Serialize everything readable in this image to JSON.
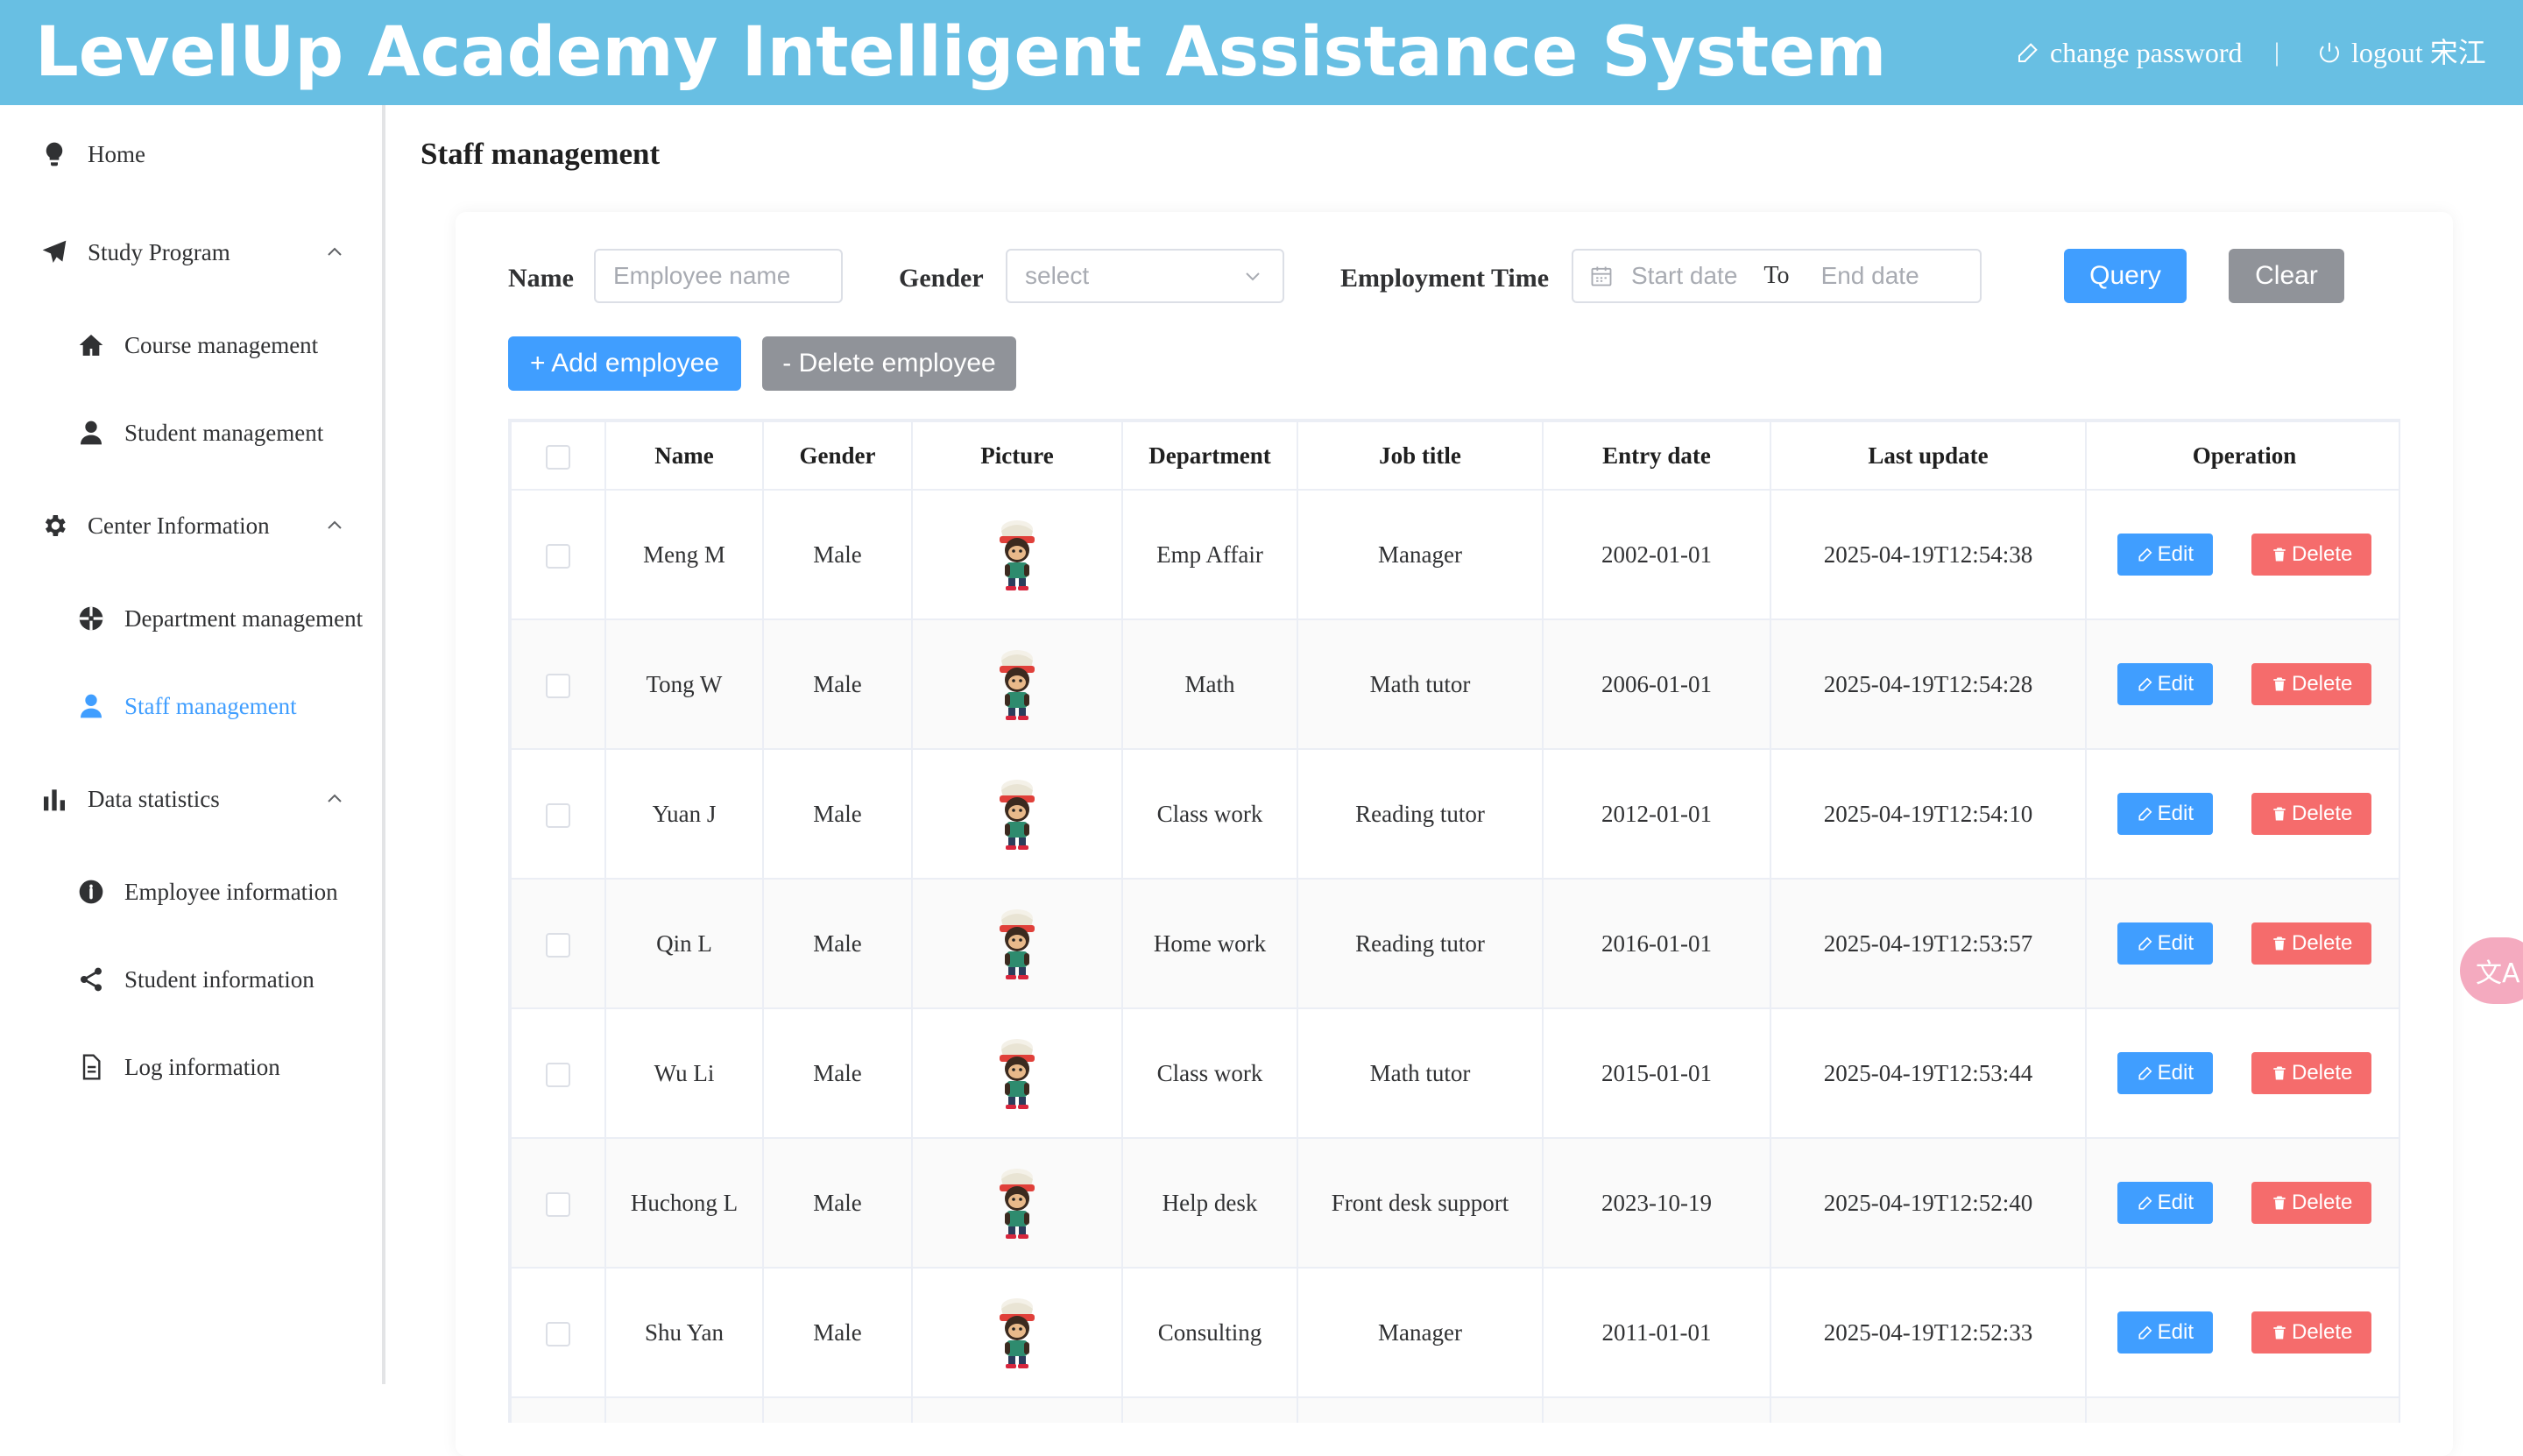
{
  "header": {
    "title": "LevelUp Academy Intelligent Assistance System",
    "change_password": "change password",
    "separator": "|",
    "logout": "logout 宋江"
  },
  "sidebar": {
    "items": [
      {
        "label": "Home",
        "icon": "lightbulb-icon"
      },
      {
        "label": "Study Program",
        "icon": "paper-plane-icon",
        "expanded": true
      },
      {
        "label": "Course management",
        "icon": "home-icon"
      },
      {
        "label": "Student management",
        "icon": "user-icon"
      },
      {
        "label": "Center Information",
        "icon": "gear-icon",
        "expanded": true
      },
      {
        "label": "Department management",
        "icon": "aperture-icon"
      },
      {
        "label": "Staff management",
        "icon": "user-icon",
        "active": true
      },
      {
        "label": "Data statistics",
        "icon": "bar-chart-icon",
        "expanded": true
      },
      {
        "label": "Employee information",
        "icon": "info-icon"
      },
      {
        "label": "Student information",
        "icon": "share-icon"
      },
      {
        "label": "Log information",
        "icon": "document-icon"
      }
    ]
  },
  "page": {
    "title": "Staff management"
  },
  "filters": {
    "name_label": "Name",
    "name_placeholder": "Employee name",
    "gender_label": "Gender",
    "gender_placeholder": "select",
    "time_label": "Employment Time",
    "start_placeholder": "Start date",
    "range_separator": "To",
    "end_placeholder": "End date",
    "query_label": "Query",
    "clear_label": "Clear"
  },
  "actions": {
    "add_label": "+ Add employee",
    "delete_label": "- Delete employee"
  },
  "table": {
    "columns": [
      "Name",
      "Gender",
      "Picture",
      "Department",
      "Job title",
      "Entry date",
      "Last update",
      "Operation"
    ],
    "edit_label": "Edit",
    "delete_label": "Delete",
    "rows": [
      {
        "name": "Meng M",
        "gender": "Male",
        "department": "Emp Affair",
        "job": "Manager",
        "entry": "2002-01-01",
        "updated": "2025-04-19T12:54:38"
      },
      {
        "name": "Tong W",
        "gender": "Male",
        "department": "Math",
        "job": "Math tutor",
        "entry": "2006-01-01",
        "updated": "2025-04-19T12:54:28"
      },
      {
        "name": "Yuan J",
        "gender": "Male",
        "department": "Class work",
        "job": "Reading tutor",
        "entry": "2012-01-01",
        "updated": "2025-04-19T12:54:10"
      },
      {
        "name": "Qin L",
        "gender": "Male",
        "department": "Home work",
        "job": "Reading tutor",
        "entry": "2016-01-01",
        "updated": "2025-04-19T12:53:57"
      },
      {
        "name": "Wu Li",
        "gender": "Male",
        "department": "Class work",
        "job": "Math tutor",
        "entry": "2015-01-01",
        "updated": "2025-04-19T12:53:44"
      },
      {
        "name": "Huchong L",
        "gender": "Male",
        "department": "Help desk",
        "job": "Front desk support",
        "entry": "2023-10-19",
        "updated": "2025-04-19T12:52:40"
      },
      {
        "name": "Shu Yan",
        "gender": "Male",
        "department": "Consulting",
        "job": "Manager",
        "entry": "2011-01-01",
        "updated": "2025-04-19T12:52:33"
      }
    ]
  },
  "translate_fab": {
    "glyph": "文A"
  },
  "colors": {
    "header": "#68bfe3",
    "primary": "#409eff",
    "danger": "#f56c6c",
    "neutral": "#909399",
    "active_nav": "#409eff"
  }
}
